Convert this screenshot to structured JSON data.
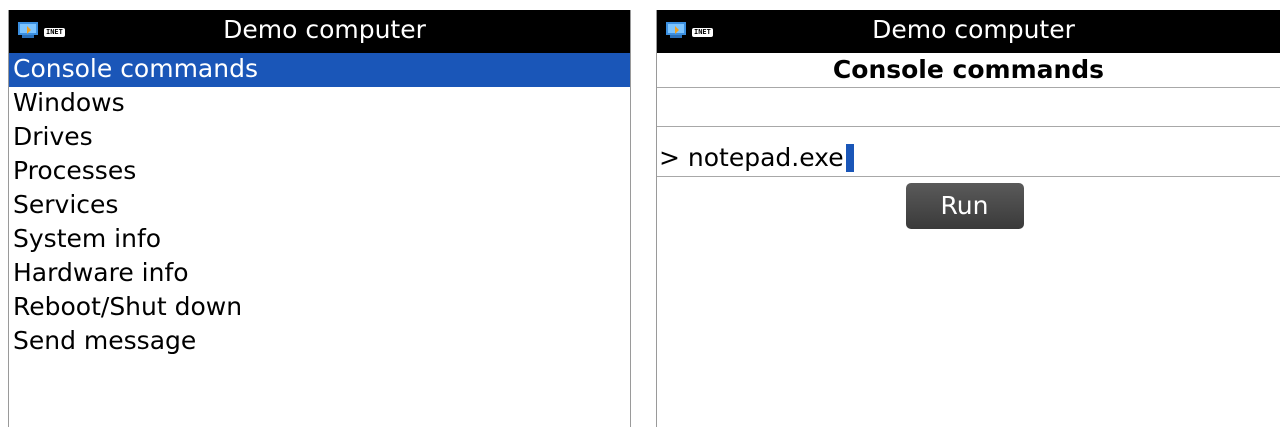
{
  "left_screen": {
    "title": "Demo computer",
    "status_badge": "INET",
    "menu": [
      {
        "label": "Console commands",
        "selected": true
      },
      {
        "label": "Windows",
        "selected": false
      },
      {
        "label": "Drives",
        "selected": false
      },
      {
        "label": "Processes",
        "selected": false
      },
      {
        "label": "Services",
        "selected": false
      },
      {
        "label": "System info",
        "selected": false
      },
      {
        "label": "Hardware info",
        "selected": false
      },
      {
        "label": "Reboot/Shut down",
        "selected": false
      },
      {
        "label": "Send message",
        "selected": false
      }
    ]
  },
  "right_screen": {
    "title": "Demo computer",
    "status_badge": "INET",
    "heading": "Console commands",
    "command_value": "> notepad.exe",
    "run_label": "Run"
  },
  "colors": {
    "title_bar": "#000000",
    "selection": "#1a56b8",
    "cursor": "#1a56b8",
    "button": "#4a4a4a"
  },
  "icons": {
    "app_icon": "monitor-icon",
    "network_badge": "inet-badge"
  }
}
